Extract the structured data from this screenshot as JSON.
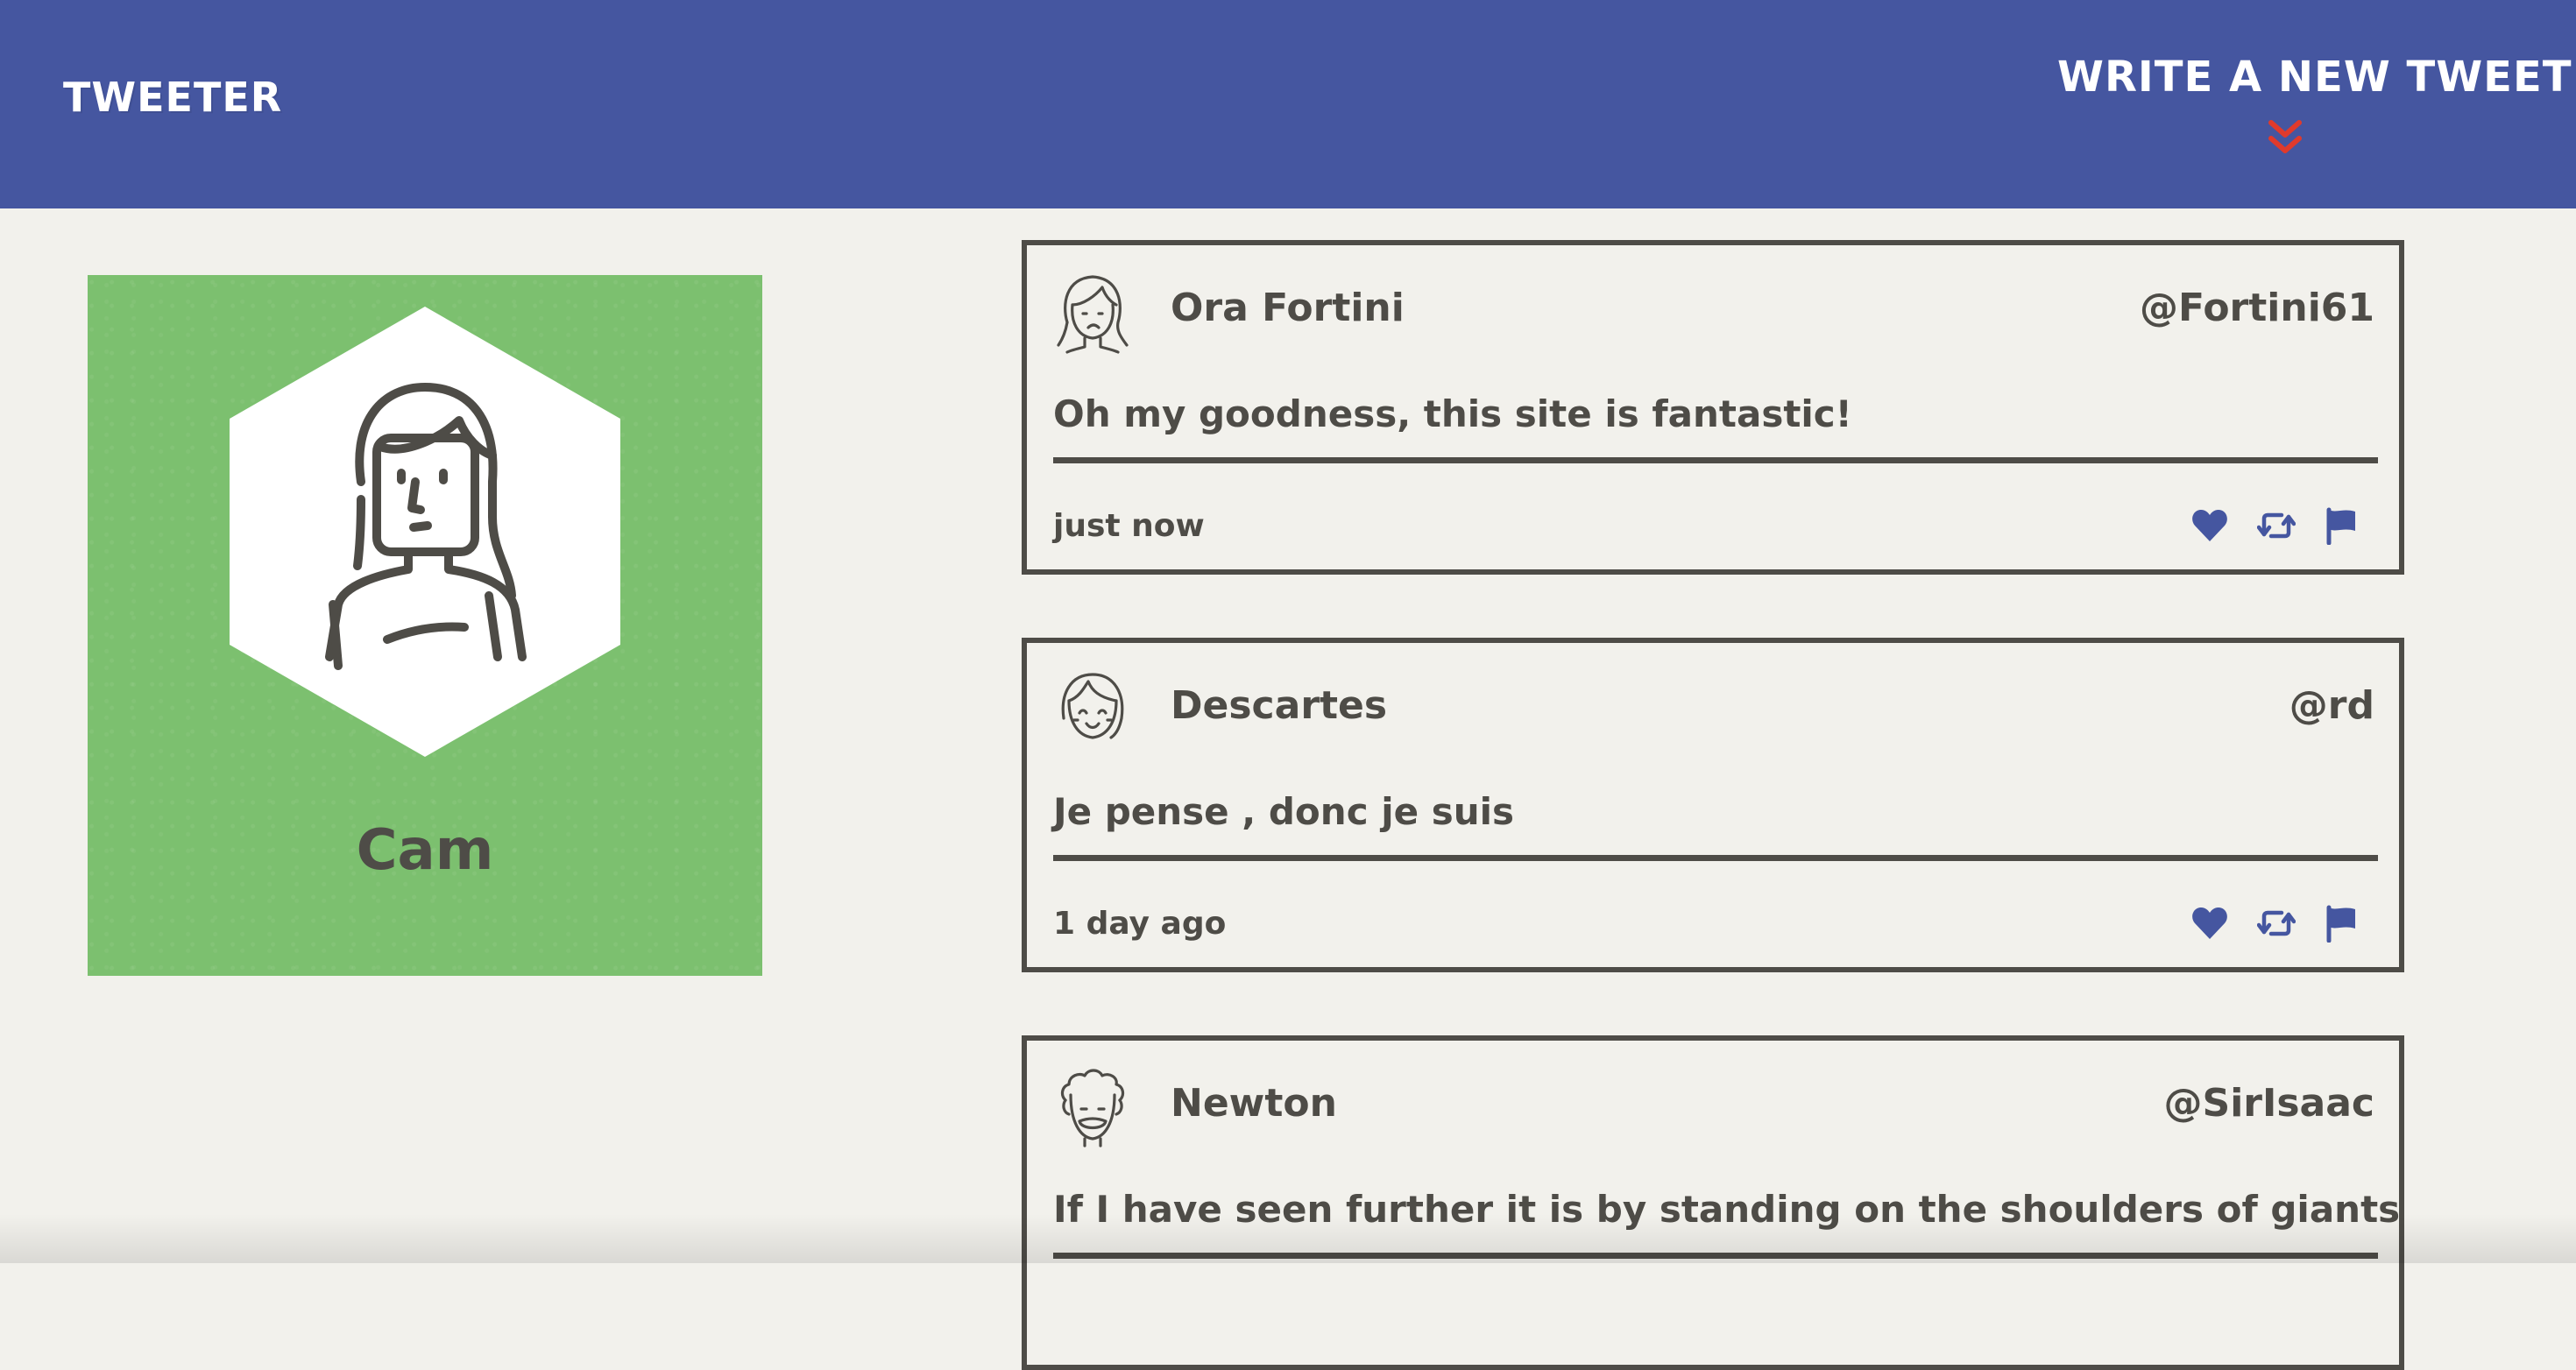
{
  "nav": {
    "brand": "TWEETER",
    "compose_label": "WRITE A NEW TWEET",
    "compose_icon": "double-chevron-down-icon",
    "compose_icon_color": "#e03a2c",
    "background": "#4556a0"
  },
  "profile": {
    "name": "Cam",
    "card_color": "#7cc06f",
    "avatar_icon": "woman-avatar-icon"
  },
  "tweets": [
    {
      "name": "Ora Fortini",
      "handle": "@Fortini61",
      "content": "Oh my goodness, this site is fantastic!",
      "time": "just now",
      "avatar_icon": "woman-avatar-icon"
    },
    {
      "name": "Descartes",
      "handle": "@rd",
      "content": "Je pense , donc je suis",
      "time": "1 day ago",
      "avatar_icon": "girl-bangs-avatar-icon"
    },
    {
      "name": "Newton",
      "handle": "@SirIsaac",
      "content": "If I have seen further it is by standing on the shoulders of giants",
      "time": "",
      "avatar_icon": "curly-hair-avatar-icon"
    }
  ],
  "actions": {
    "like_icon": "heart-icon",
    "retweet_icon": "retweet-icon",
    "flag_icon": "flag-icon",
    "color": "#4556a0"
  }
}
